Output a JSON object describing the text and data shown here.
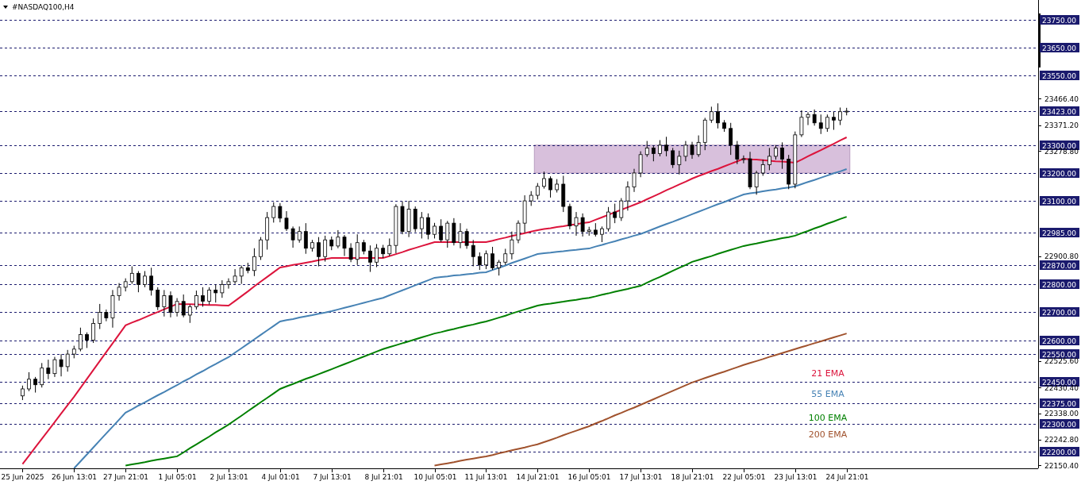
{
  "chart": {
    "chart_data": {
      "type": "candlestick",
      "title": "#NASDAQ100,H4",
      "categories": [
        null,
        null,
        null,
        "25 Jun 2025",
        null,
        null,
        null,
        null,
        null,
        null,
        null,
        "26 Jun 13:01",
        null,
        null,
        null,
        null,
        null,
        null,
        null,
        "27 Jun 21:01",
        null,
        null,
        null,
        null,
        null,
        null,
        null,
        "1 Jul 05:01",
        null,
        null,
        null,
        null,
        null,
        null,
        null,
        "2 Jul 13:01",
        null,
        null,
        null,
        null,
        null,
        null,
        null,
        "4 Jul 01:01",
        null,
        null,
        null,
        null,
        null,
        null,
        null,
        "7 Jul 13:01",
        null,
        null,
        null,
        null,
        null,
        null,
        null,
        "8 Jul 21:01",
        null,
        null,
        null,
        null,
        null,
        null,
        null,
        "10 Jul 05:01",
        null,
        null,
        null,
        null,
        null,
        null,
        null,
        "11 Jul 13:01",
        null,
        null,
        null,
        null,
        null,
        null,
        null,
        "14 Jul 21:01",
        null,
        null,
        null,
        null,
        null,
        null,
        null,
        "16 Jul 05:01",
        null,
        null,
        null,
        null,
        null,
        null,
        null,
        "17 Jul 13:01",
        null,
        null,
        null,
        null,
        null,
        null,
        null,
        "18 Jul 21:01",
        null,
        null,
        null,
        null,
        null,
        null,
        null,
        "22 Jul 05:01",
        null,
        null,
        null,
        null,
        null,
        null,
        null,
        "23 Jul 13:01",
        null,
        null,
        null,
        null,
        null,
        null,
        null,
        "24 Jul 21:01",
        null,
        null,
        null,
        null,
        null,
        null,
        null,
        null,
        null,
        null,
        null,
        null,
        null,
        null,
        null,
        null,
        null,
        null,
        null,
        null,
        null,
        null,
        null,
        null,
        null,
        null,
        null,
        null,
        null
      ],
      "ohlc": [
        null,
        null,
        null,
        [
          22400,
          22437,
          22385,
          22425
        ],
        [
          22425,
          22485,
          22417,
          22460
        ],
        [
          22460,
          22468,
          22412,
          22440
        ],
        [
          22440,
          22518,
          22430,
          22500
        ],
        [
          22500,
          22530,
          22460,
          22480
        ],
        [
          22480,
          22540,
          22468,
          22530
        ],
        [
          22530,
          22550,
          22470,
          22505
        ],
        [
          22505,
          22565,
          22487,
          22550
        ],
        [
          22550,
          22580,
          22535,
          22568
        ],
        [
          22568,
          22645,
          22560,
          22620
        ],
        [
          22620,
          22628,
          22572,
          22600
        ],
        [
          22600,
          22678,
          22590,
          22660
        ],
        [
          22660,
          22730,
          22640,
          22700
        ],
        [
          22700,
          22710,
          22668,
          22680
        ],
        [
          22680,
          22780,
          22645,
          22760
        ],
        [
          22760,
          22805,
          22742,
          22790
        ],
        [
          22790,
          22822,
          22775,
          22810
        ],
        [
          22810,
          22865,
          22802,
          22840
        ],
        [
          22840,
          22848,
          22772,
          22800
        ],
        [
          22800,
          22848,
          22790,
          22830
        ],
        [
          22830,
          22860,
          22760,
          22780
        ],
        [
          22780,
          22790,
          22708,
          22720
        ],
        [
          22720,
          22780,
          22685,
          22760
        ],
        [
          22760,
          22775,
          22682,
          22700
        ],
        [
          22700,
          22751,
          22685,
          22739
        ],
        [
          22739,
          22764,
          22682,
          22690
        ],
        [
          22690,
          22728,
          22662,
          22720
        ],
        [
          22720,
          22778,
          22710,
          22760
        ],
        [
          22760,
          22790,
          22720,
          22740
        ],
        [
          22740,
          22790,
          22728,
          22780
        ],
        [
          22780,
          22800,
          22735,
          22770
        ],
        [
          22770,
          22815,
          22752,
          22800
        ],
        [
          22800,
          22822,
          22785,
          22810
        ],
        [
          22810,
          22855,
          22802,
          22830
        ],
        [
          22830,
          22868,
          22802,
          22860
        ],
        [
          22860,
          22878,
          22840,
          22850
        ],
        [
          22850,
          22930,
          22830,
          22900
        ],
        [
          22900,
          22970,
          22888,
          22960
        ],
        [
          22960,
          23060,
          22925,
          23040
        ],
        [
          23040,
          23095,
          23022,
          23080
        ],
        [
          23080,
          23092,
          23023,
          23038
        ],
        [
          23038,
          23063,
          22992,
          23000
        ],
        [
          23000,
          23008,
          22932,
          22960
        ],
        [
          22960,
          23008,
          22950,
          22990
        ],
        [
          22990,
          23020,
          22910,
          22930
        ],
        [
          22930,
          22960,
          22918,
          22950
        ],
        [
          22950,
          22970,
          22865,
          22900
        ],
        [
          22900,
          22975,
          22882,
          22960
        ],
        [
          22960,
          22972,
          22923,
          22938
        ],
        [
          22938,
          22995,
          22930,
          22970
        ],
        [
          22970,
          22978,
          22902,
          22930
        ],
        [
          22930,
          22948,
          22880,
          22890
        ],
        [
          22890,
          22980,
          22870,
          22950
        ],
        [
          22950,
          22960,
          22908,
          22920
        ],
        [
          22920,
          22940,
          22845,
          22880
        ],
        [
          22880,
          22945,
          22862,
          22930
        ],
        [
          22930,
          22942,
          22895,
          22910
        ],
        [
          22910,
          22965,
          22902,
          22940
        ],
        [
          22940,
          23088,
          22912,
          23080
        ],
        [
          23080,
          23098,
          22980,
          22990
        ],
        [
          22990,
          23100,
          22970,
          23070
        ],
        [
          23070,
          23080,
          22988,
          23000
        ],
        [
          23000,
          23060,
          22965,
          23040
        ],
        [
          23040,
          23055,
          22962,
          22980
        ],
        [
          22980,
          23021,
          22965,
          23009
        ],
        [
          23009,
          23034,
          22952,
          22960
        ],
        [
          22960,
          23028,
          22932,
          23020
        ],
        [
          23020,
          23038,
          22940,
          22950
        ],
        [
          22950,
          23020,
          22930,
          22990
        ],
        [
          22990,
          23000,
          22928,
          22940
        ],
        [
          22940,
          22960,
          22865,
          22900
        ],
        [
          22900,
          22915,
          22852,
          22870
        ],
        [
          22870,
          22922,
          22855,
          22910
        ],
        [
          22910,
          22935,
          22852,
          22860
        ],
        [
          22860,
          22888,
          22832,
          22880
        ],
        [
          22880,
          22928,
          22870,
          22910
        ],
        [
          22910,
          22990,
          22890,
          22960
        ],
        [
          22960,
          23030,
          22948,
          23020
        ],
        [
          23020,
          23120,
          22985,
          23100
        ],
        [
          23100,
          23135,
          23082,
          23120
        ],
        [
          23120,
          23164,
          23105,
          23152
        ],
        [
          23152,
          23205,
          23144,
          23180
        ],
        [
          23180,
          23188,
          23112,
          23140
        ],
        [
          23140,
          23178,
          23130,
          23160
        ],
        [
          23160,
          23190,
          23060,
          23080
        ],
        [
          23080,
          23090,
          22998,
          23010
        ],
        [
          23010,
          23060,
          22975,
          23040
        ],
        [
          23040,
          23055,
          22972,
          22990
        ],
        [
          22990,
          23007,
          22975,
          22995
        ],
        [
          22995,
          23020,
          22972,
          22980
        ],
        [
          22980,
          23008,
          22952,
          23000
        ],
        [
          23000,
          23078,
          22990,
          23060
        ],
        [
          23060,
          23090,
          23020,
          23040
        ],
        [
          23040,
          23110,
          23028,
          23100
        ],
        [
          23100,
          23170,
          23065,
          23150
        ],
        [
          23150,
          23215,
          23132,
          23200
        ],
        [
          23200,
          23278,
          23185,
          23266
        ],
        [
          23266,
          23315,
          23258,
          23290
        ],
        [
          23290,
          23298,
          23242,
          23270
        ],
        [
          23270,
          23318,
          23260,
          23300
        ],
        [
          23300,
          23330,
          23260,
          23280
        ],
        [
          23280,
          23290,
          23218,
          23230
        ],
        [
          23230,
          23280,
          23195,
          23260
        ],
        [
          23260,
          23315,
          23242,
          23300
        ],
        [
          23300,
          23312,
          23251,
          23266
        ],
        [
          23266,
          23335,
          23258,
          23310
        ],
        [
          23310,
          23398,
          23282,
          23390
        ],
        [
          23390,
          23438,
          23380,
          23420
        ],
        [
          23420,
          23450,
          23360,
          23380
        ],
        [
          23380,
          23390,
          23348,
          23360
        ],
        [
          23360,
          23380,
          23265,
          23300
        ],
        [
          23300,
          23315,
          23232,
          23250
        ],
        [
          23250,
          23263,
          23235,
          23251
        ],
        [
          23251,
          23276,
          23142,
          23150
        ],
        [
          23150,
          23208,
          23122,
          23200
        ],
        [
          23200,
          23248,
          23190,
          23230
        ],
        [
          23230,
          23290,
          23210,
          23260
        ],
        [
          23260,
          23300,
          23248,
          23290
        ],
        [
          23290,
          23310,
          23215,
          23250
        ],
        [
          23250,
          23265,
          23142,
          23160
        ],
        [
          23160,
          23349,
          23145,
          23337
        ],
        [
          23337,
          23425,
          23329,
          23400
        ],
        [
          23400,
          23418,
          23372,
          23410
        ],
        [
          23410,
          23428,
          23370,
          23380
        ],
        [
          23380,
          23410,
          23340,
          23360
        ],
        [
          23360,
          23410,
          23348,
          23400
        ],
        [
          23400,
          23420,
          23355,
          23390
        ],
        [
          23390,
          23435,
          23372,
          23420
        ],
        [
          23420,
          23434,
          23407,
          23422
        ],
        null,
        null,
        null,
        null,
        null,
        null,
        null,
        null,
        null,
        null,
        null,
        null,
        null,
        null,
        null,
        null,
        null,
        null,
        null,
        null,
        null,
        null,
        null,
        null,
        null,
        null,
        null,
        null,
        null
      ],
      "color": "#000000",
      "ylim": [
        22140,
        23821
      ],
      "yticks": [
        {
          "value": 23466.4,
          "label": "23466.40"
        },
        {
          "value": 23371.2,
          "label": "23371.20"
        },
        {
          "value": 23278.8,
          "label": "23278.80"
        },
        {
          "value": 22900.8,
          "label": "22900.80"
        },
        {
          "value": 22525.6,
          "label": "22525.60"
        },
        {
          "value": 22430.4,
          "label": "22430.40"
        },
        {
          "value": 22338,
          "label": "22338.00"
        },
        {
          "value": 22242.8,
          "label": "22242.80"
        },
        {
          "value": 22150.4,
          "label": "22150.40"
        }
      ],
      "bands": [
        {
          "axis": "y",
          "from": 23200,
          "to": 23300,
          "color": "#d8c0dc"
        }
      ],
      "ref_lines": [
        {
          "axis": "y",
          "value": 23750,
          "label": "23750.00"
        },
        {
          "axis": "y",
          "value": 23650,
          "label": "23650.00"
        },
        {
          "axis": "y",
          "value": 23550,
          "label": "23550.00"
        },
        {
          "axis": "y",
          "value": 23423,
          "label": "23423.00"
        },
        {
          "axis": "y",
          "value": 23300,
          "label": "23300.00"
        },
        {
          "axis": "y",
          "value": 23200,
          "label": "23200.00"
        },
        {
          "axis": "y",
          "value": 23100,
          "label": "23100.00"
        },
        {
          "axis": "y",
          "value": 22985,
          "label": "22985.00"
        },
        {
          "axis": "y",
          "value": 22870,
          "label": "22870.00"
        },
        {
          "axis": "y",
          "value": 22800,
          "label": "22800.00"
        },
        {
          "axis": "y",
          "value": 22700,
          "label": "22700.00"
        },
        {
          "axis": "y",
          "value": 22600,
          "label": "22600.00"
        },
        {
          "axis": "y",
          "value": 22550,
          "label": "22550.00"
        },
        {
          "axis": "y",
          "value": 22450,
          "label": "22450.00"
        },
        {
          "axis": "y",
          "value": 22375,
          "label": "22375.00"
        },
        {
          "axis": "y",
          "value": 22300,
          "label": "22300.00"
        },
        {
          "axis": "y",
          "value": 22200,
          "label": "22200.00"
        }
      ],
      "series": [
        {
          "name": "21 EMA",
          "type": "line",
          "color": "#dc143c",
          "values": [
            null,
            null,
            null,
            22155,
            22185,
            22216,
            22246,
            22276,
            22306,
            22337,
            22367,
            22397,
            22429,
            22461,
            22493,
            22525,
            22557,
            22589,
            22621,
            22653,
            22663,
            22672,
            22682,
            22692,
            22701,
            22711,
            22720,
            22730,
            22729,
            22729,
            22728,
            22727,
            22726,
            22726,
            22725,
            22724,
            22741,
            22758,
            22775,
            22793,
            22810,
            22827,
            22844,
            22861,
            22865,
            22870,
            22874,
            22878,
            22882,
            22887,
            22891,
            22895,
            22895,
            22895,
            22895,
            22895,
            22895,
            22895,
            22895,
            22895,
            22902,
            22909,
            22916,
            22924,
            22931,
            22938,
            22945,
            22952,
            22952,
            22952,
            22952,
            22952,
            22952,
            22952,
            22952,
            22952,
            22957,
            22963,
            22968,
            22974,
            22979,
            22984,
            22990,
            22995,
            22999,
            23002,
            23006,
            23009,
            23013,
            23016,
            23020,
            23023,
            23032,
            23041,
            23050,
            23059,
            23068,
            23077,
            23086,
            23095,
            23106,
            23116,
            23127,
            23138,
            23148,
            23159,
            23169,
            23180,
            23189,
            23198,
            23207,
            23215,
            23224,
            23233,
            23242,
            23251,
            23249,
            23248,
            23246,
            23244,
            23242,
            23241,
            23239,
            23237,
            23248,
            23260,
            23271,
            23282,
            23294,
            23305,
            23317,
            23328,
            null,
            null,
            null,
            null,
            null,
            null,
            null,
            null,
            null,
            null,
            null,
            null,
            null,
            null,
            null,
            null,
            null,
            null,
            null,
            null,
            null,
            null,
            null,
            null,
            null,
            null,
            null,
            null,
            null
          ]
        },
        {
          "name": "55 EMA",
          "type": "line",
          "color": "#4682b4",
          "values": [
            null,
            null,
            null,
            null,
            null,
            null,
            null,
            null,
            null,
            null,
            null,
            22140,
            22165,
            22190,
            22215,
            22240,
            22265,
            22290,
            22315,
            22340,
            22352,
            22365,
            22377,
            22390,
            22402,
            22414,
            22427,
            22439,
            22452,
            22464,
            22477,
            22489,
            22502,
            22514,
            22527,
            22539,
            22555,
            22571,
            22587,
            22603,
            22619,
            22635,
            22651,
            22667,
            22672,
            22676,
            22681,
            22686,
            22690,
            22695,
            22699,
            22704,
            22710,
            22716,
            22722,
            22728,
            22734,
            22740,
            22746,
            22752,
            22761,
            22770,
            22779,
            22788,
            22797,
            22806,
            22815,
            22824,
            22827,
            22829,
            22832,
            22834,
            22837,
            22839,
            22842,
            22844,
            22852,
            22860,
            22868,
            22877,
            22885,
            22893,
            22901,
            22909,
            22912,
            22914,
            22917,
            22919,
            22922,
            22924,
            22927,
            22929,
            22936,
            22942,
            22949,
            22955,
            22962,
            22968,
            22975,
            22981,
            22990,
            22999,
            23008,
            23017,
            23025,
            23034,
            23043,
            23052,
            23061,
            23070,
            23079,
            23088,
            23096,
            23105,
            23114,
            23123,
            23127,
            23130,
            23134,
            23138,
            23141,
            23145,
            23148,
            23152,
            23160,
            23168,
            23175,
            23183,
            23191,
            23199,
            23206,
            23214,
            null,
            null,
            null,
            null,
            null,
            null,
            null,
            null,
            null,
            null,
            null,
            null,
            null,
            null,
            null,
            null,
            null,
            null,
            null,
            null,
            null,
            null,
            null,
            null,
            null,
            null,
            null,
            null,
            null
          ]
        },
        {
          "name": "100 EMA",
          "type": "line",
          "color": "#008000",
          "values": [
            null,
            null,
            null,
            null,
            null,
            null,
            null,
            null,
            null,
            null,
            null,
            null,
            null,
            null,
            null,
            null,
            null,
            null,
            null,
            22150,
            22154,
            22158,
            22162,
            22167,
            22171,
            22175,
            22179,
            22183,
            22197,
            22212,
            22226,
            22240,
            22254,
            22269,
            22283,
            22297,
            22313,
            22329,
            22345,
            22361,
            22377,
            22393,
            22409,
            22425,
            22434,
            22443,
            22452,
            22461,
            22469,
            22478,
            22487,
            22496,
            22505,
            22514,
            22523,
            22532,
            22541,
            22550,
            22559,
            22568,
            22575,
            22582,
            22589,
            22596,
            22603,
            22610,
            22617,
            22624,
            22629,
            22635,
            22640,
            22646,
            22651,
            22656,
            22662,
            22667,
            22674,
            22681,
            22688,
            22696,
            22703,
            22710,
            22717,
            22724,
            22728,
            22731,
            22735,
            22738,
            22742,
            22745,
            22749,
            22752,
            22757,
            22763,
            22768,
            22774,
            22779,
            22784,
            22790,
            22795,
            22806,
            22817,
            22827,
            22838,
            22849,
            22860,
            22870,
            22881,
            22888,
            22895,
            22902,
            22910,
            22917,
            22924,
            22931,
            22938,
            22943,
            22947,
            22952,
            22957,
            22961,
            22966,
            22970,
            22975,
            22984,
            22992,
            23001,
            23009,
            23018,
            23026,
            23035,
            23043,
            null,
            null,
            null,
            null,
            null,
            null,
            null,
            null,
            null,
            null,
            null,
            null,
            null,
            null,
            null,
            null,
            null,
            null,
            null,
            null,
            null,
            null,
            null,
            null,
            null,
            null,
            null,
            null,
            null
          ]
        },
        {
          "name": "200 EMA",
          "type": "line",
          "color": "#a0522d",
          "values": [
            null,
            null,
            null,
            null,
            null,
            null,
            null,
            null,
            null,
            null,
            null,
            null,
            null,
            null,
            null,
            null,
            null,
            null,
            null,
            null,
            null,
            null,
            null,
            null,
            null,
            null,
            null,
            null,
            null,
            null,
            null,
            null,
            null,
            null,
            null,
            null,
            null,
            null,
            null,
            null,
            null,
            null,
            null,
            null,
            null,
            null,
            null,
            null,
            null,
            null,
            null,
            null,
            null,
            null,
            null,
            null,
            null,
            null,
            null,
            null,
            null,
            null,
            null,
            null,
            null,
            null,
            null,
            22150,
            22154,
            22158,
            22162,
            22167,
            22171,
            22175,
            22179,
            22183,
            22188,
            22194,
            22199,
            22205,
            22210,
            22215,
            22221,
            22226,
            22234,
            22242,
            22250,
            22259,
            22267,
            22275,
            22283,
            22291,
            22301,
            22310,
            22320,
            22330,
            22339,
            22349,
            22358,
            22368,
            22378,
            22388,
            22398,
            22408,
            22418,
            22428,
            22438,
            22448,
            22456,
            22464,
            22472,
            22480,
            22487,
            22495,
            22503,
            22511,
            22518,
            22525,
            22532,
            22540,
            22547,
            22554,
            22561,
            22568,
            22575,
            22582,
            22589,
            22596,
            22603,
            22610,
            22617,
            22624,
            null,
            null,
            null,
            null,
            null,
            null,
            null,
            null,
            null,
            null,
            null,
            null,
            null,
            null,
            null,
            null,
            null,
            null,
            null,
            null,
            null,
            null,
            null,
            null,
            null,
            null,
            null,
            null,
            null
          ]
        }
      ]
    }
  }
}
